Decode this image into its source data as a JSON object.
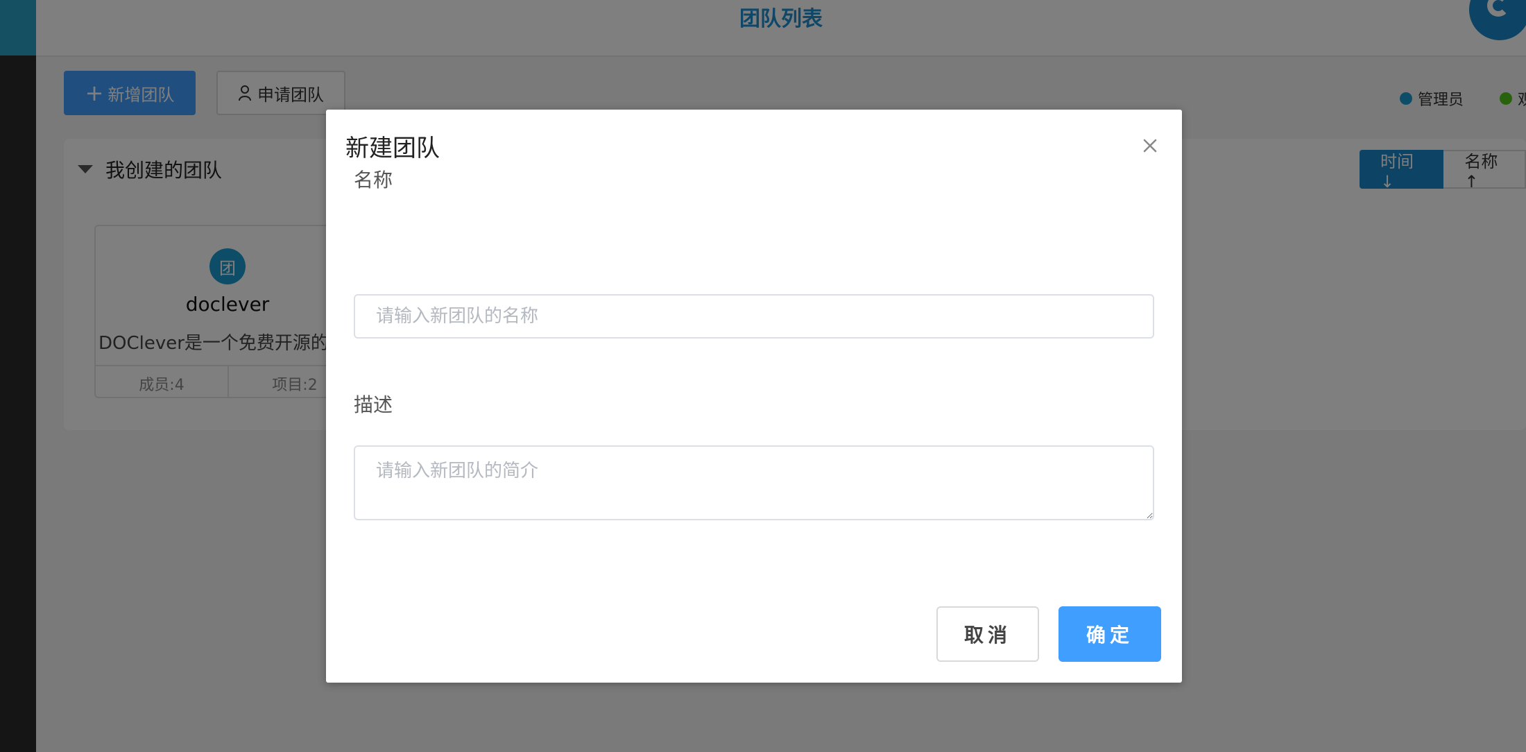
{
  "header": {
    "title": "团队列表"
  },
  "toolbar": {
    "add_team_label": "新增团队",
    "apply_team_label": "申请团队"
  },
  "legend": {
    "items": [
      {
        "label": "管理员",
        "color": "#1a9bd0"
      },
      {
        "label": "观",
        "color": "#52c41a"
      }
    ]
  },
  "section": {
    "title": "我创建的团队",
    "sort": {
      "time_label": "时间 ↓",
      "name_label": "名称 ↑"
    }
  },
  "team_card": {
    "avatar_text": "团",
    "name": "doclever",
    "description": "DOClever是一个免费开源的产品",
    "members": "成员:4",
    "projects": "项目:2"
  },
  "dialog": {
    "title": "新建团队",
    "name_label": "名称",
    "name_placeholder": "请输入新团队的名称",
    "desc_label": "描述",
    "desc_placeholder": "请输入新团队的简介",
    "cancel_label": "取消",
    "confirm_label": "确定"
  },
  "colors": {
    "primary": "#409eff",
    "brand": "#1a86c8",
    "title_blue": "#1c8ed1"
  }
}
